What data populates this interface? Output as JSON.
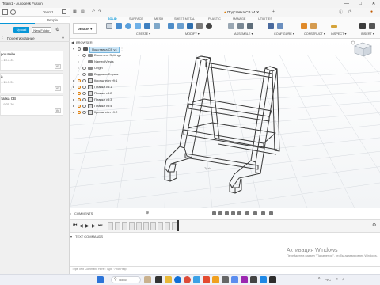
{
  "window": {
    "title": "Team1 - Autodesk Fusion",
    "controls": [
      "—",
      "□",
      "✕"
    ]
  },
  "data_panel": {
    "user": "Team1",
    "tabs": [
      "",
      "People"
    ],
    "upload_label": "Upload",
    "new_folder_label": "New Folder",
    "path": "Проектирование",
    "items": [
      {
        "name": "роштейн",
        "sub": "...15.3.31",
        "version": "V1"
      },
      {
        "name": "а",
        "sub": "...15.3.31",
        "version": "V1"
      },
      {
        "name": "тавка CB",
        "sub": "...9.35.36",
        "version": "V4"
      }
    ]
  },
  "document_tab": {
    "title": "Подставка CB v4"
  },
  "ribbon": {
    "tabs": [
      "SOLID",
      "SURFACE",
      "MESH",
      "SHEET METAL",
      "PLASTIC",
      "MANAGE",
      "UTILITIES"
    ],
    "active_tab": "SOLID",
    "workspace": "DESIGN ▾",
    "groups": [
      "CREATE ▾",
      "MODIFY ▾",
      "ASSEMBLE ▾",
      "CONFIGURE ▾",
      "CONSTRUCT ▾",
      "INSPECT ▾",
      "INSERT ▾"
    ]
  },
  "browser": {
    "header": "BROWSER",
    "root": "Подставка CB v4",
    "nodes": [
      "Document Settings",
      "Named Views",
      "Origin",
      "ВидимыеФормы",
      "Кронштейн v9:1",
      "Планка v3:1",
      "Планка v3:2",
      "Планка v3:3",
      "Планка v3:4",
      "Кронштейн v9:2"
    ]
  },
  "viewport": {
    "axis_label": "Tyzh"
  },
  "comments": {
    "label": "COMMENTS"
  },
  "text_commands": {
    "label": "TEXT COMMANDS",
    "input_placeholder": "Type Text Command Here : Type '?' for Help"
  },
  "activation": {
    "line1": "Активация Windows",
    "line2": "Перейдите в раздел \"Параметры\", чтобы активировать Windows."
  },
  "taskbar": {
    "search_placeholder": "Поиск",
    "lang": "РУС",
    "time": "",
    "date": ""
  },
  "colors": {
    "accent": "#0696d7",
    "timeline_feature": "#e6e6e6",
    "model_stroke": "#3a3a3a"
  }
}
